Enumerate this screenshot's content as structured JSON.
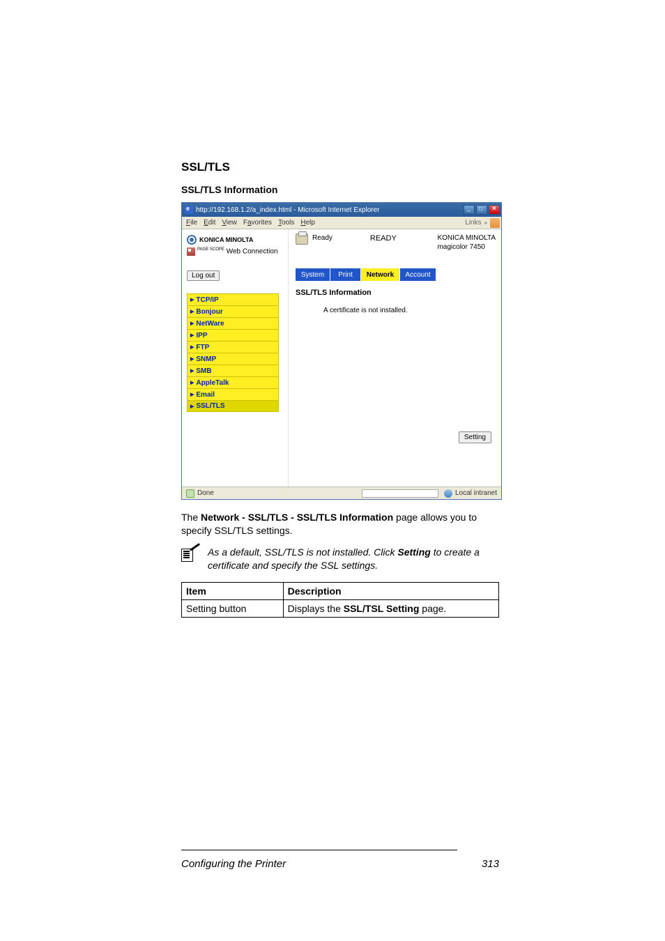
{
  "section_heading": "SSL/TLS",
  "subsection_heading": "SSL/TLS Information",
  "ie_window": {
    "title": "http://192.168.1.2/a_index.html - Microsoft Internet Explorer",
    "menubar": [
      "File",
      "Edit",
      "View",
      "Favorites",
      "Tools",
      "Help"
    ],
    "links_label": "Links",
    "left": {
      "brand": "KONICA MINOLTA",
      "pagescope_small": "PAGE SCOPE",
      "pagescope": "Web Connection",
      "logout": "Log out",
      "nav_items": [
        "TCP/IP",
        "Bonjour",
        "NetWare",
        "IPP",
        "FTP",
        "SNMP",
        "SMB",
        "AppleTalk",
        "Email",
        "SSL/TLS"
      ],
      "active_index": 9
    },
    "right": {
      "ready_small": "Ready",
      "ready_big": "READY",
      "device_name": "KONICA MINOLTA",
      "device_model": "magicolor 7450",
      "tabs": [
        "System",
        "Print",
        "Network",
        "Account"
      ],
      "active_tab_index": 2,
      "content_title": "SSL/TLS Information",
      "content_body": "A certificate is not installed.",
      "setting_button": "Setting"
    },
    "statusbar": {
      "done": "Done",
      "zone": "Local intranet"
    }
  },
  "description": {
    "pre": "The ",
    "bold_path": "Network - SSL/TLS - SSL/TLS Information",
    "post": " page allows you to specify SSL/TLS settings."
  },
  "note": {
    "pre": "As a default, SSL/TLS is not installed. Click ",
    "bold": "Setting",
    "post": " to create a certificate and specify the SSL settings."
  },
  "table": {
    "col_item": "Item",
    "col_desc": "Description",
    "row1_item": "Setting button",
    "row1_desc_pre": "Displays the ",
    "row1_desc_bold": "SSL/TSL Setting",
    "row1_desc_post": " page."
  },
  "footer": {
    "left": "Configuring the Printer",
    "right": "313"
  }
}
